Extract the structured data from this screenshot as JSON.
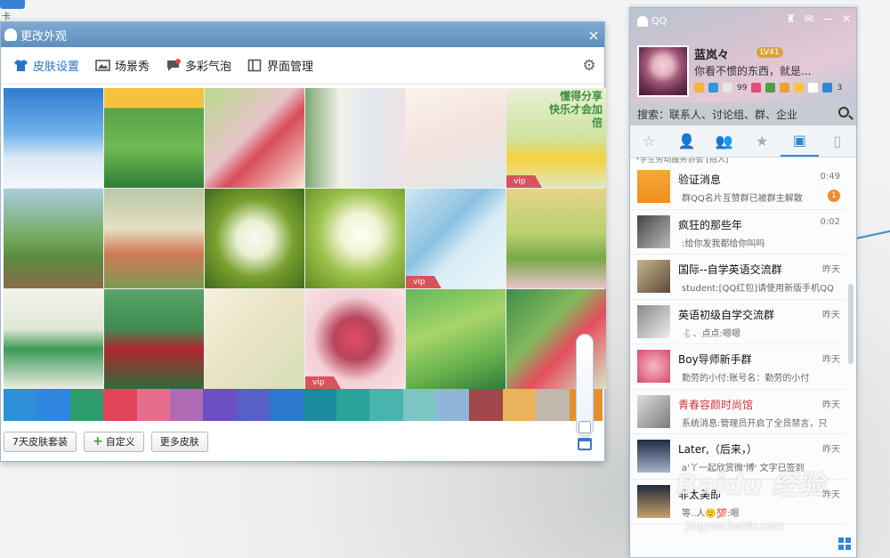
{
  "desktop": {
    "icon_text": "卡"
  },
  "skin_window": {
    "title": "更改外观",
    "close": "×",
    "tabs": [
      {
        "label": "皮肤设置"
      },
      {
        "label": "场景秀"
      },
      {
        "label": "多彩气泡"
      },
      {
        "label": "界面管理"
      }
    ],
    "tiles": [
      {
        "name": "sky-clouds",
        "bg": "linear-gradient(#2f7bd0,#6fb1ea 45%,#dbe9f6 70%,#f4f8fc)",
        "vip": false
      },
      {
        "name": "shop-cartoon",
        "bg": "linear-gradient(#f4c23c 0,#f4c23c 20%,#58a24a 20%,#6fba55 60%,#2f7d35)",
        "vip": false
      },
      {
        "name": "flower-house",
        "bg": "linear-gradient(135deg,#b9d98a,#e7c4c9 45%,#d94a5a 60%,#f7e9d8)",
        "vip": false
      },
      {
        "name": "white-alley",
        "bg": "linear-gradient(90deg,#7ca870,#f3f1ea 35%,#dfe8ee 65%,#f1e2e4)",
        "vip": false
      },
      {
        "name": "pink-blossom",
        "bg": "linear-gradient(160deg,#fbf3ec,#f4e1dc 50%,#dde9ea)",
        "vip": false
      },
      {
        "name": "yellow-daisy-share",
        "bg": "linear-gradient(#e9f0d8,#cfe3a0 50%,#f5d23d 70%,#dfe8c0)",
        "vip": true,
        "text": "懂得分享　快乐才会加倍"
      },
      {
        "name": "cartoon-park",
        "bg": "linear-gradient(#a9cde0,#74a85c 50%,#5b8a3f 70%,#8b6b4a)",
        "vip": false
      },
      {
        "name": "field-bicycle",
        "bg": "linear-gradient(#b9c7a8,#e6e0c0 40%,#d27a56 65%,#7a9a52)",
        "vip": false
      },
      {
        "name": "white-flower",
        "bg": "radial-gradient(circle at 50% 50%,#fbfbf4 0,#e9f0d2 25%,#7aa02f 55%,#3e6a1c)",
        "vip": false
      },
      {
        "name": "white-flower-green",
        "bg": "radial-gradient(circle at 55% 45%,#fffef5 0,#f1f4d6 25%,#9cc24a 55%,#5e8b24)",
        "vip": false
      },
      {
        "name": "blue-bow",
        "bg": "linear-gradient(135deg,#cfe6f0,#8cc1e2 40%,#d9eef6 60%,#eaf4f8)",
        "vip": true
      },
      {
        "name": "window-flowers",
        "bg": "linear-gradient(#e8d38a,#b7d070 45%,#78a847 70%,#eac3c9)",
        "vip": false
      },
      {
        "name": "green-leaf",
        "bg": "linear-gradient(#f4f2ec,#dfe7d6 40%,#3f9a57 60%,#e9eee4)",
        "vip": false
      },
      {
        "name": "cup-flowers",
        "bg": "linear-gradient(#5ba36a,#3e8b4f 40%,#b0262f 60%,#2f6b3b)",
        "vip": false
      },
      {
        "name": "bird-branch",
        "bg": "linear-gradient(135deg,#f5f0dc,#e9e3c4 50%,#d6dfb7)",
        "vip": false
      },
      {
        "name": "butterfly-pink",
        "bg": "radial-gradient(circle at 50% 50%,#e14b66 0,#b9455a 30%,#f3cfd6 60%,#fae3e8)",
        "vip": true
      },
      {
        "name": "green-sprouts",
        "bg": "linear-gradient(160deg,#63b85a,#a7d56a 40%,#6ab34f 70%,#2f7c3b)",
        "vip": false
      },
      {
        "name": "red-blossom",
        "bg": "linear-gradient(135deg,#3f8e4a,#85b85d 40%,#e44f5d 60%,#d7e5c8)",
        "vip": false
      }
    ],
    "swatch_colors": [
      "#2d8fd8",
      "#2f86e0",
      "#2e9d6d",
      "#e2445a",
      "#e76d8c",
      "#b06bb5",
      "#6c4fc2",
      "#5561c4",
      "#2e77cf",
      "#1a8a9c",
      "#2aa39a",
      "#49b3ad",
      "#7cc5c3",
      "#8fb6d8",
      "#a2474a",
      "#e8b35a",
      "#c0b7ad",
      "#e58f2f"
    ],
    "buttons": {
      "seven_day": "7天皮肤套装",
      "custom": "自定义",
      "more": "更多皮肤"
    }
  },
  "qq": {
    "brand": "QQ",
    "nickname": "蓝岚々",
    "level": "LV41",
    "signature": "你看不惯的东西，就是...",
    "count_badge": "3",
    "bubble_count": "99",
    "search_placeholder": "搜索：联系人、讨论组、群、企业",
    "cut_text": "*学生劳动服务协会 [招入]",
    "contacts": [
      {
        "name": "验证消息",
        "msg": "群QQ名片互赞群已被群主解散",
        "time": "0:49",
        "badge": "1",
        "av": "linear-gradient(#f4a73a,#ee8f1c)",
        "red": false
      },
      {
        "name": "疯狂的那些年",
        "msg": ":给你发我都给你叫吗",
        "time": "0:02",
        "badge": "",
        "av": "linear-gradient(135deg,#444,#bbb)",
        "red": false
      },
      {
        "name": "国际--自学英语交流群",
        "msg": "student:[QQ红包]请使用新版手机QQ",
        "time": "昨天",
        "badge": "",
        "av": "linear-gradient(135deg,#c8b48a,#5b4a3a)",
        "red": false
      },
      {
        "name": "英语初级自学交流群",
        "msg": "🐇、点点:嗯嗯",
        "time": "昨天",
        "badge": "",
        "av": "linear-gradient(135deg,#888,#eee)",
        "red": false
      },
      {
        "name": "Boy导师新手群",
        "msg": "勤劳的小付:账号名：勤劳的小付",
        "time": "昨天",
        "badge": "",
        "av": "radial-gradient(circle,#f6b8c7,#d64a6a)",
        "red": false
      },
      {
        "name": "青春容颜时尚馆",
        "msg": "系统消息:管理员开启了全员禁言，只",
        "time": "昨天",
        "badge": "",
        "av": "linear-gradient(135deg,#ddd,#7a7a7a)",
        "red": true
      },
      {
        "name": "Later,（后来，）",
        "msg": "a'丫一起欣赏微'博' 文字已签到",
        "time": "昨天",
        "badge": "",
        "av": "linear-gradient(#1c2a44,#a6b4c8)",
        "red": false
      },
      {
        "name": "非太美即",
        "msg": "等..人🙂💯:嗯",
        "time": "昨天",
        "badge": "",
        "av": "linear-gradient(#1f2b3a,#c9a06a)",
        "red": false
      }
    ]
  },
  "watermark": {
    "main": "Baidu 经验",
    "sub": "jingyan.baidu.com"
  }
}
